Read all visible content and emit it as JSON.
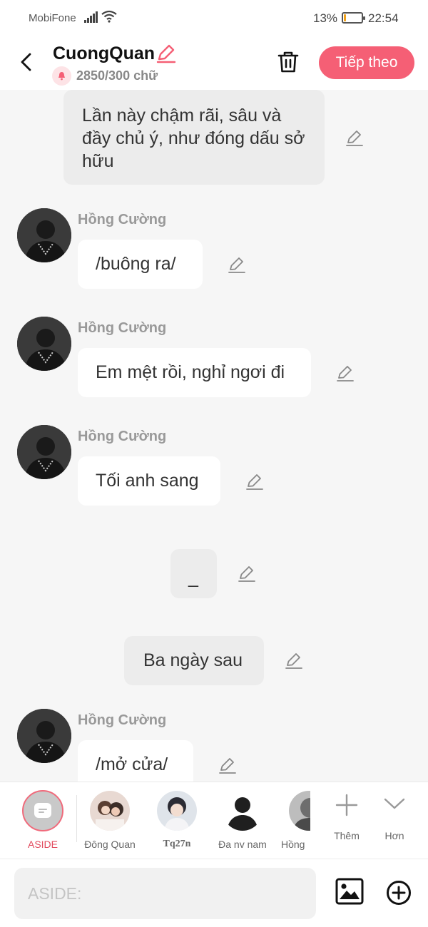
{
  "status_bar": {
    "carrier": "MobiFone",
    "battery_percent": "13%",
    "battery_level": 0.13,
    "time": "22:54"
  },
  "header": {
    "title": "CuongQuan",
    "counter": "2850/300 chữ",
    "next_label": "Tiếp theo",
    "accent_color": "#f55f75"
  },
  "messages": [
    {
      "kind": "narration",
      "text": "Lần này chậm rãi, sâu và đầy chủ ý, như đóng dấu sở hữu"
    },
    {
      "kind": "speech",
      "speaker": "Hồng Cường",
      "text": "/buông ra/"
    },
    {
      "kind": "speech",
      "speaker": "Hồng Cường",
      "text": "Em mệt rồi, nghỉ ngơi đi"
    },
    {
      "kind": "speech",
      "speaker": "Hồng Cường",
      "text": "Tối anh sang"
    },
    {
      "kind": "narration",
      "text": "_"
    },
    {
      "kind": "narration",
      "text": "Ba ngày sau"
    },
    {
      "kind": "speech",
      "speaker": "Hồng Cường",
      "text": "/mở cửa/"
    }
  ],
  "characters": {
    "aside_label": "ASIDE",
    "items": [
      {
        "name": "Đông Quan"
      },
      {
        "name": "Tq27n"
      },
      {
        "name": "Đa nv nam"
      },
      {
        "name": "Hồng"
      }
    ],
    "add_label": "Thêm",
    "more_label": "Hơn"
  },
  "input": {
    "placeholder": "ASIDE:"
  }
}
